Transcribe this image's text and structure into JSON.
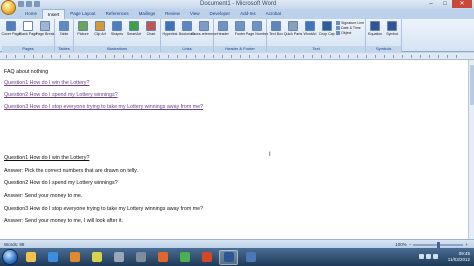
{
  "window": {
    "title": "Document1 - Microsoft Word",
    "minimize": "–",
    "maximize": "□",
    "close": "✕"
  },
  "tabs": [
    "Home",
    "Insert",
    "Page Layout",
    "References",
    "Mailings",
    "Review",
    "View",
    "Developer",
    "Add-Ins",
    "Acrobat"
  ],
  "active_tab": "Insert",
  "ribbon": {
    "groups": [
      {
        "label": "Pages",
        "buttons": [
          {
            "label": "Cover Page",
            "icon": "cover-page-icon",
            "color": "#4f7fc0"
          },
          {
            "label": "Blank Page",
            "icon": "blank-page-icon",
            "color": "#ffffff"
          },
          {
            "label": "Page Break",
            "icon": "page-break-icon",
            "color": "#9fb5d4"
          }
        ]
      },
      {
        "label": "Tables",
        "buttons": [
          {
            "label": "Table",
            "icon": "table-icon",
            "color": "#5b8bc9"
          }
        ]
      },
      {
        "label": "Illustrations",
        "buttons": [
          {
            "label": "Picture",
            "icon": "picture-icon",
            "color": "#6aa457"
          },
          {
            "label": "Clip Art",
            "icon": "clip-art-icon",
            "color": "#d59a3a"
          },
          {
            "label": "Shapes",
            "icon": "shapes-icon",
            "color": "#4a7fc2"
          },
          {
            "label": "SmartArt",
            "icon": "smartart-icon",
            "color": "#3fa04a"
          },
          {
            "label": "Chart",
            "icon": "chart-icon",
            "color": "#c65252"
          }
        ]
      },
      {
        "label": "Links",
        "buttons": [
          {
            "label": "Hyperlink",
            "icon": "hyperlink-icon",
            "color": "#3b73bd"
          },
          {
            "label": "Bookmark",
            "icon": "bookmark-icon",
            "color": "#5a87c5"
          },
          {
            "label": "Cross-reference",
            "icon": "cross-reference-icon",
            "color": "#7d9ccb"
          }
        ]
      },
      {
        "label": "Header & Footer",
        "buttons": [
          {
            "label": "Header",
            "icon": "header-icon",
            "color": "#6f93c6"
          },
          {
            "label": "Footer",
            "icon": "footer-icon",
            "color": "#6f93c6"
          },
          {
            "label": "Page Number",
            "icon": "page-number-icon",
            "color": "#6f93c6"
          }
        ]
      },
      {
        "label": "Text",
        "buttons": [
          {
            "label": "Text Box",
            "icon": "text-box-icon",
            "color": "#5c86c0"
          },
          {
            "label": "Quick Parts",
            "icon": "quick-parts-icon",
            "color": "#8a9fc0"
          },
          {
            "label": "WordArt",
            "icon": "wordart-icon",
            "color": "#3f74c0"
          },
          {
            "label": "Drop Cap",
            "icon": "drop-cap-icon",
            "color": "#2e5d9e"
          }
        ]
      },
      {
        "label": "Symbols",
        "buttons": [
          {
            "label": "Equation",
            "icon": "equation-icon",
            "color": "#2f5597"
          },
          {
            "label": "Symbol",
            "icon": "symbol-icon",
            "color": "#2f5597"
          }
        ]
      }
    ],
    "text_small": [
      "Signature Line",
      "Date & Time",
      "Object"
    ]
  },
  "document": {
    "lines": [
      "FAQ about nothing",
      "Question1 How do I win the Lottery?",
      "Question2 How do I spend my Lottery winnings?",
      "Question3 How do I stop everyone trying to take my Lottery winnings away from me?",
      "Question1 How do I win the Lottery?",
      "Answer: Pick the correct numbers that are drawn on telly.",
      "Question2 How do I spend my Lottery winnings?",
      "Answer: Send your money to me.",
      "Question3 How do I stop everyone trying to take my Lottery winnings away from me?",
      "Answer: Send your money to me, I will look after it."
    ]
  },
  "status": {
    "words": "Words: 98",
    "zoom": "100%"
  },
  "taskbar": {
    "apps": [
      {
        "name": "explorer-icon",
        "color": "#f2c14e"
      },
      {
        "name": "ie-icon",
        "color": "#3b8ee0"
      },
      {
        "name": "media-player-icon",
        "color": "#e28a2b"
      },
      {
        "name": "paint-icon",
        "color": "#d9d24b"
      },
      {
        "name": "tool-icon",
        "color": "#9aa7b8"
      },
      {
        "name": "camera-icon",
        "color": "#7f8c9a"
      },
      {
        "name": "firefox-icon",
        "color": "#e2652a"
      },
      {
        "name": "chrome-icon",
        "color": "#4caf50"
      },
      {
        "name": "powerpoint-icon",
        "color": "#d24726"
      },
      {
        "name": "word-icon",
        "color": "#2b5797"
      },
      {
        "name": "notes-icon",
        "color": "#4a78b5"
      }
    ],
    "active_app": 9,
    "time": "09:45",
    "date": "11/03/2012"
  }
}
